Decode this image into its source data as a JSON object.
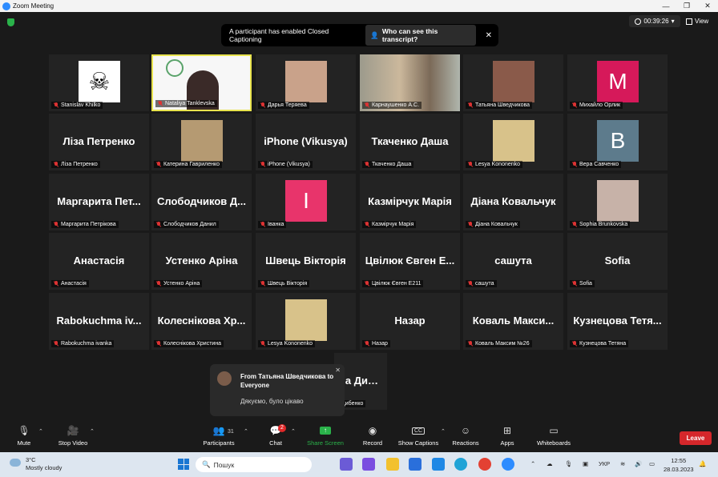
{
  "window": {
    "title": "Zoom Meeting",
    "controls": [
      "—",
      "❐",
      "✕"
    ]
  },
  "top": {
    "timer": "00:39:26",
    "view_label": "View"
  },
  "banner": {
    "message": "A participant has enabled Closed Captioning",
    "button": "Who can see this transcript?",
    "close": "✕"
  },
  "tiles": [
    {
      "name": "Stanislav Khilko",
      "big": "",
      "avatar": "pirate"
    },
    {
      "name": "Nataliya Tanklevska",
      "big": "",
      "avatar": "woman-white",
      "active": true
    },
    {
      "name": "Дарья Теряева",
      "big": "",
      "avatar": "face"
    },
    {
      "name": "Карнаушенко А.С.",
      "big": "",
      "avatar": "video"
    },
    {
      "name": "Татьяна Шведчикова",
      "big": "",
      "avatar": "face2"
    },
    {
      "name": "Михайло Орлик",
      "big": "",
      "avatar": "letter",
      "letter": "M",
      "color": "#d6195a"
    },
    {
      "name": "Ліза Петренко",
      "big": "Ліза Петренко"
    },
    {
      "name": "Катерина Гавриленко",
      "big": "",
      "avatar": "face3"
    },
    {
      "name": "iPhone (Vikusya)",
      "big": "iPhone (Vikusya)"
    },
    {
      "name": "Ткаченко Даша",
      "big": "Ткаченко Даша"
    },
    {
      "name": "Lesya Kononenko",
      "big": "",
      "avatar": "face4"
    },
    {
      "name": "Вера Савченко",
      "big": "",
      "avatar": "letter",
      "letter": "B",
      "color": "#5d7b8c"
    },
    {
      "name": "Маргарита Петрікова",
      "big": "Маргарита Пет..."
    },
    {
      "name": "Слободчиков Данил",
      "big": "Слободчиков Д..."
    },
    {
      "name": "Іванка",
      "big": "",
      "avatar": "letter",
      "letter": "I",
      "color": "#e8346b"
    },
    {
      "name": "Казмірчук Марія",
      "big": "Казмірчук Марія"
    },
    {
      "name": "Діана Ковальчук",
      "big": "Діана Ковальчук"
    },
    {
      "name": "Sophia Brunkovska",
      "big": "",
      "avatar": "face5"
    },
    {
      "name": "Анастасія",
      "big": "Анастасія"
    },
    {
      "name": "Устенко Аріна",
      "big": "Устенко Аріна"
    },
    {
      "name": "Швець Вікторія",
      "big": "Швець Вікторія"
    },
    {
      "name": "Цвілюк Євген Е211",
      "big": "Цвілюк Євген Е..."
    },
    {
      "name": "сашута",
      "big": "сашута"
    },
    {
      "name": "Sofia",
      "big": "Sofia"
    },
    {
      "name": "Rabokuchma ivanka",
      "big": "Rabokuchma iv..."
    },
    {
      "name": "Колеснікова Христина",
      "big": "Колеснікова Хр..."
    },
    {
      "name": "Lesya Kononenko",
      "big": "",
      "avatar": "face4"
    },
    {
      "name": "Назар",
      "big": "Назар"
    },
    {
      "name": "Коваль Максим №26",
      "big": "Коваль Макси..."
    },
    {
      "name": "Кузнецова Тетяна",
      "big": "Кузнецова Тетя..."
    }
  ],
  "extra_tile": {
    "big": "на Дибенко",
    "label": "Дибенко"
  },
  "chat_popup": {
    "from": "From Татьяна Шведчикова to Everyone",
    "message": "Дякуємо, було цікаво",
    "close": "✕"
  },
  "toolbar": {
    "mute": "Mute",
    "stop_video": "Stop Video",
    "participants": "Participants",
    "participants_count": "31",
    "chat": "Chat",
    "chat_badge": "2",
    "share_screen": "Share Screen",
    "record": "Record",
    "show_captions": "Show Captions",
    "reactions": "Reactions",
    "apps": "Apps",
    "whiteboards": "Whiteboards",
    "leave": "Leave"
  },
  "taskbar": {
    "weather_temp": "3°C",
    "weather_text": "Mostly cloudy",
    "search_placeholder": "Пошук",
    "lang": "УКР",
    "time": "12:55",
    "date": "28.03.2023"
  }
}
